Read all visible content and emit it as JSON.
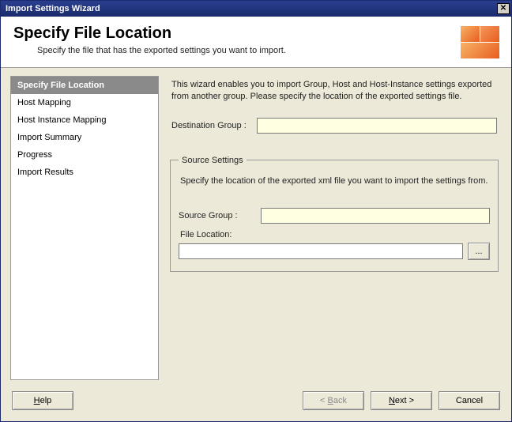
{
  "window": {
    "title": "Import Settings Wizard"
  },
  "header": {
    "title": "Specify File Location",
    "subtitle": "Specify the file that has the exported settings you want to import."
  },
  "sidebar": {
    "items": [
      {
        "label": "Specify File Location",
        "active": true
      },
      {
        "label": "Host Mapping",
        "active": false
      },
      {
        "label": "Host Instance Mapping",
        "active": false
      },
      {
        "label": "Import Summary",
        "active": false
      },
      {
        "label": "Progress",
        "active": false
      },
      {
        "label": "Import Results",
        "active": false
      }
    ]
  },
  "main": {
    "intro": "This wizard enables you to import Group, Host and Host-Instance settings exported from another group. Please specify the location of the exported settings file.",
    "dest_label": "Destination Group :",
    "dest_value": "",
    "source_fieldset": {
      "legend": "Source Settings",
      "description": "Specify the location of the exported xml file you want to import the settings from.",
      "source_group_label": "Source Group :",
      "source_group_value": "",
      "file_location_label": "File Location:",
      "file_location_value": "",
      "browse_label": "..."
    }
  },
  "footer": {
    "help": "Help",
    "back": "< Back",
    "next": "Next >",
    "cancel": "Cancel"
  }
}
